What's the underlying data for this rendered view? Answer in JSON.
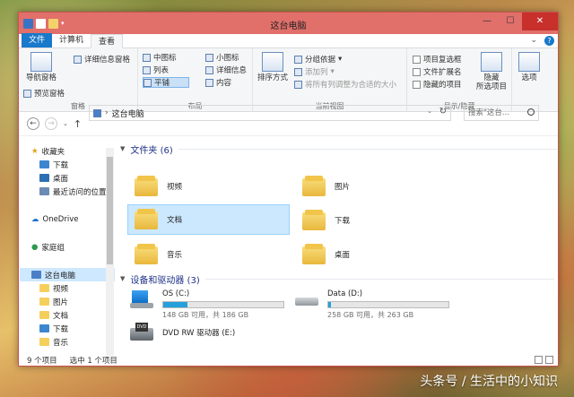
{
  "window": {
    "title": "这台电脑"
  },
  "ribbon_tabs": [
    "文件",
    "计算机",
    "查看"
  ],
  "ribbon": {
    "pane_group": {
      "label": "窗格",
      "nav_pane": "导航窗格",
      "preview_pane": "预览窗格",
      "details_pane": "详细信息窗格"
    },
    "layout_group": {
      "label": "布局",
      "items": [
        "中图标",
        "小图标",
        "列表",
        "详细信息",
        "平铺",
        "内容"
      ]
    },
    "view_group": {
      "label": "当前视图",
      "sort": "排序方式",
      "group_by": "分组依据",
      "add_column": "添加列",
      "fit_columns": "将所有列调整为合适的大小"
    },
    "showhide_group": {
      "label": "显示/隐藏",
      "item_checkbox": "项目复选框",
      "file_ext": "文件扩展名",
      "hidden_items": "隐藏的项目",
      "hide": "隐藏",
      "selected_items": "所选项目"
    },
    "options": "选项"
  },
  "address": {
    "path": "这台电脑",
    "search_placeholder": "搜索\"这台..."
  },
  "nav": {
    "favorites": "收藏夹",
    "items": [
      "下载",
      "桌面",
      "最近访问的位置"
    ],
    "onedrive": "OneDrive",
    "homegroup": "家庭组",
    "thispc": "这台电脑",
    "pc_items": [
      "视频",
      "图片",
      "文档",
      "下载",
      "音乐"
    ]
  },
  "folders": {
    "header": "文件夹 (6)",
    "items": [
      "视频",
      "图片",
      "文档",
      "下载",
      "音乐",
      "桌面"
    ]
  },
  "drives": {
    "header": "设备和驱动器 (3)",
    "list": [
      {
        "name": "OS (C:)",
        "free": "148 GB 可用，共 186 GB",
        "used_pct": 20
      },
      {
        "name": "Data (D:)",
        "free": "258 GB 可用，共 263 GB",
        "used_pct": 2
      },
      {
        "name": "DVD RW 驱动器 (E:)"
      }
    ]
  },
  "status": {
    "count": "9 个项目",
    "selected": "选中 1 个项目"
  },
  "watermark": "头条号 / 生活中的小知识",
  "colors": {
    "titlebar": "#e16f6a",
    "accent": "#1979ca",
    "selection": "#cce8ff"
  }
}
